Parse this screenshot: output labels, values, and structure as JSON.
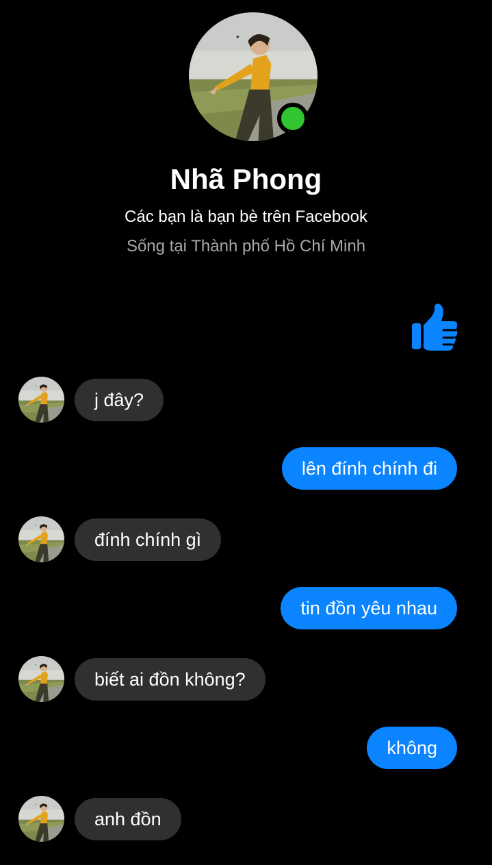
{
  "profile": {
    "name": "Nhã Phong",
    "relationship": "Các bạn là bạn bè trên Facebook",
    "location": "Sống tại Thành phố Hồ Chí Minh",
    "online": true
  },
  "colors": {
    "background": "#000000",
    "outgoing_bubble": "#0a84ff",
    "incoming_bubble": "#303030",
    "online": "#31c531",
    "secondary_text": "#a8a8a8"
  },
  "reactions": {
    "like_icon": "thumbs-up-icon"
  },
  "messages": [
    {
      "direction": "in",
      "text": "j đây?"
    },
    {
      "direction": "out",
      "text": "lên đính chính đi"
    },
    {
      "direction": "in",
      "text": "đính chính gì"
    },
    {
      "direction": "out",
      "text": "tin đồn yêu nhau"
    },
    {
      "direction": "in",
      "text": "biết ai đồn không?"
    },
    {
      "direction": "out",
      "text": "không"
    },
    {
      "direction": "in",
      "text": "anh đồn"
    }
  ]
}
